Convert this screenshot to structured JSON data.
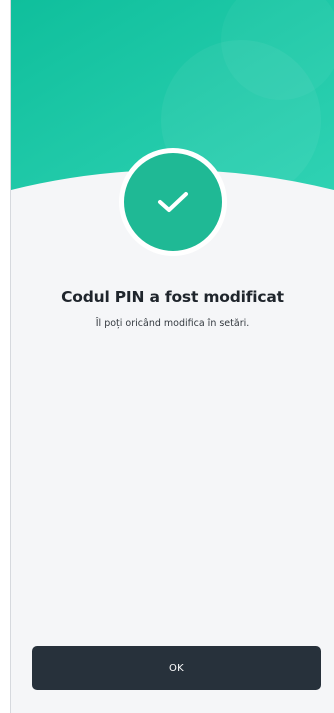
{
  "status": {
    "icon": "checkmark-icon",
    "color": "#1fb995",
    "background_gradient": [
      "#0fbf9c",
      "#2fd2b3"
    ],
    "title": "Codul PIN a fost modificat",
    "subtitle": "Îl poți oricând modifica în setări."
  },
  "actions": {
    "ok_label": "OK",
    "ok_color": "#27313b"
  }
}
